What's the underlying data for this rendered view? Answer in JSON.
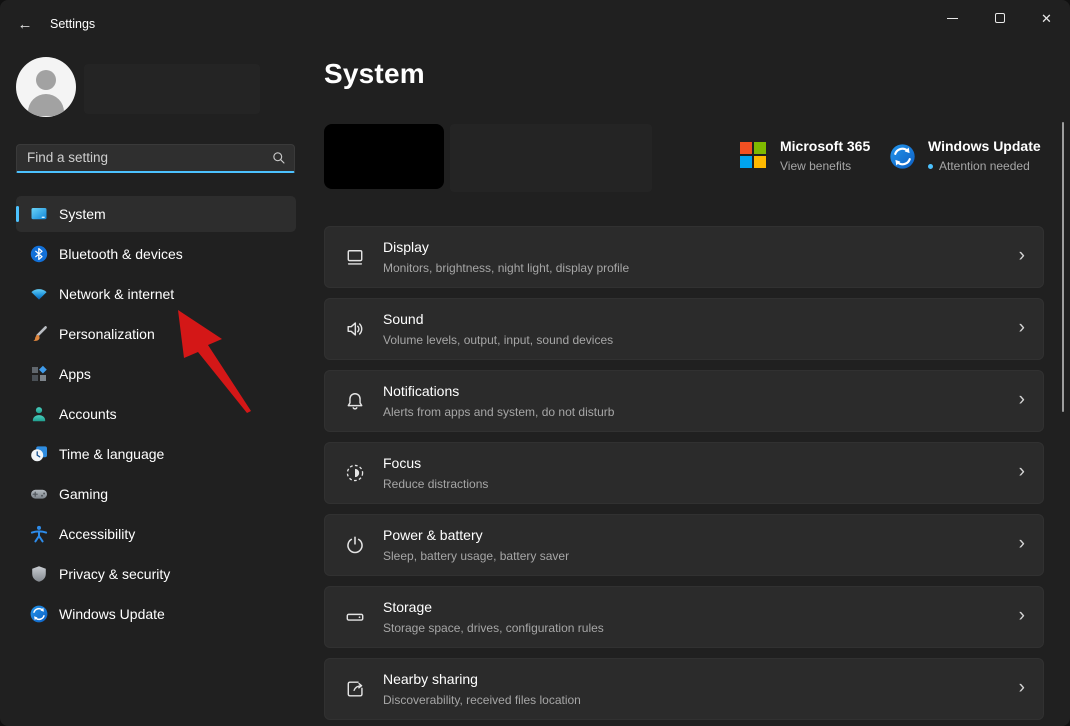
{
  "window": {
    "titlebar": {
      "title": "Settings",
      "back_glyph": "←",
      "close_glyph": "✕",
      "controls": [
        "minimize-icon",
        "maximize-icon",
        "close-icon"
      ]
    }
  },
  "sidebar": {
    "search": {
      "placeholder": "Find a setting",
      "icon": "search-icon"
    },
    "items": [
      {
        "label": "System",
        "icon": "system-icon",
        "selected": true
      },
      {
        "label": "Bluetooth & devices",
        "icon": "bluetooth-icon",
        "selected": false
      },
      {
        "label": "Network & internet",
        "icon": "network-icon",
        "selected": false
      },
      {
        "label": "Personalization",
        "icon": "personalization-icon",
        "selected": false
      },
      {
        "label": "Apps",
        "icon": "apps-icon",
        "selected": false
      },
      {
        "label": "Accounts",
        "icon": "accounts-icon",
        "selected": false
      },
      {
        "label": "Time & language",
        "icon": "time-language-icon",
        "selected": false
      },
      {
        "label": "Gaming",
        "icon": "gaming-icon",
        "selected": false
      },
      {
        "label": "Accessibility",
        "icon": "accessibility-icon",
        "selected": false
      },
      {
        "label": "Privacy & security",
        "icon": "privacy-security-icon",
        "selected": false
      },
      {
        "label": "Windows Update",
        "icon": "windows-update-icon",
        "selected": false
      }
    ]
  },
  "main": {
    "page_title": "System",
    "header_cards": [
      {
        "title": "Microsoft 365",
        "subtitle": "View benefits",
        "icon": "microsoft-logo"
      },
      {
        "title": "Windows Update",
        "subtitle": "Attention needed",
        "icon": "windows-update-badge",
        "has_status_dot": true
      }
    ],
    "chevron_glyph": "›",
    "rows": [
      {
        "title": "Display",
        "subtitle": "Monitors, brightness, night light, display profile",
        "icon": "display-icon"
      },
      {
        "title": "Sound",
        "subtitle": "Volume levels, output, input, sound devices",
        "icon": "sound-icon"
      },
      {
        "title": "Notifications",
        "subtitle": "Alerts from apps and system, do not disturb",
        "icon": "notifications-icon"
      },
      {
        "title": "Focus",
        "subtitle": "Reduce distractions",
        "icon": "focus-icon"
      },
      {
        "title": "Power & battery",
        "subtitle": "Sleep, battery usage, battery saver",
        "icon": "power-icon"
      },
      {
        "title": "Storage",
        "subtitle": "Storage space, drives, configuration rules",
        "icon": "storage-icon"
      },
      {
        "title": "Nearby sharing",
        "subtitle": "Discoverability, received files location",
        "icon": "nearby-sharing-icon"
      }
    ]
  },
  "annotation": {
    "type": "red-arrow",
    "points_to": "Network & internet"
  },
  "colors": {
    "accent": "#4cc2ff",
    "background": "#202020",
    "card": "#2b2b2b",
    "arrow_red": "#d41717",
    "text_secondary": "#a6a6a6",
    "status_dot": "#4cc2ff"
  }
}
